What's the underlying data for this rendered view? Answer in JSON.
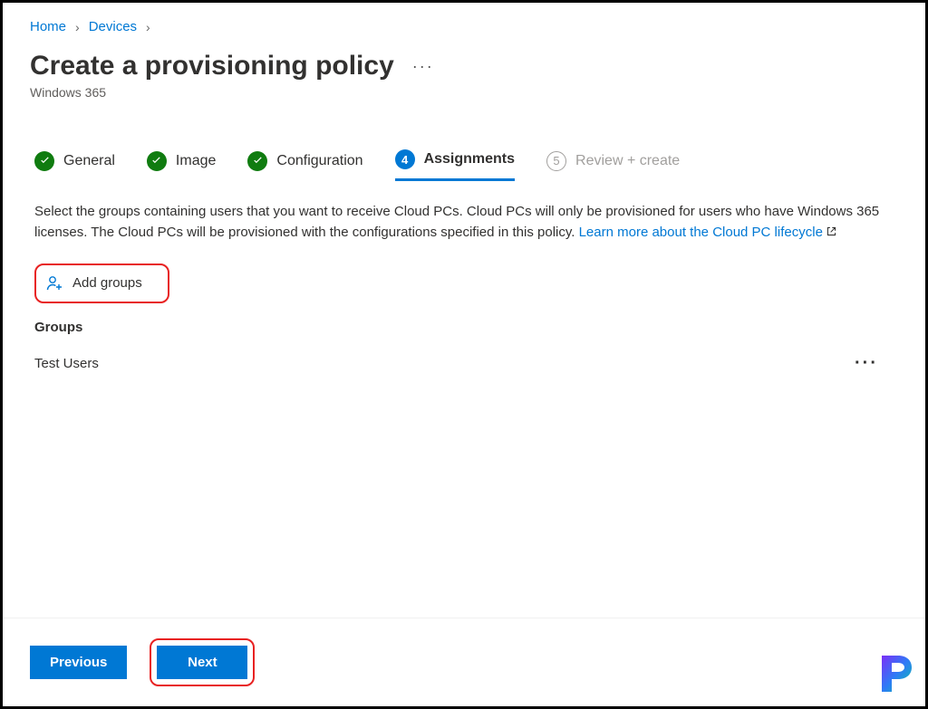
{
  "breadcrumb": {
    "home": "Home",
    "devices": "Devices"
  },
  "header": {
    "title": "Create a provisioning policy",
    "subtitle": "Windows 365"
  },
  "tabs": {
    "general": "General",
    "image": "Image",
    "configuration": "Configuration",
    "assignments_num": "4",
    "assignments": "Assignments",
    "review_num": "5",
    "review": "Review + create"
  },
  "content": {
    "description": "Select the groups containing users that you want to receive Cloud PCs. Cloud PCs will only be provisioned for users who have Windows 365 licenses. The Cloud PCs will be provisioned with the configurations specified in this policy. ",
    "learn_link": "Learn more about the Cloud PC lifecycle",
    "add_groups": "Add groups",
    "groups_header": "Groups",
    "groups": [
      {
        "name": "Test Users"
      }
    ]
  },
  "footer": {
    "previous": "Previous",
    "next": "Next"
  }
}
